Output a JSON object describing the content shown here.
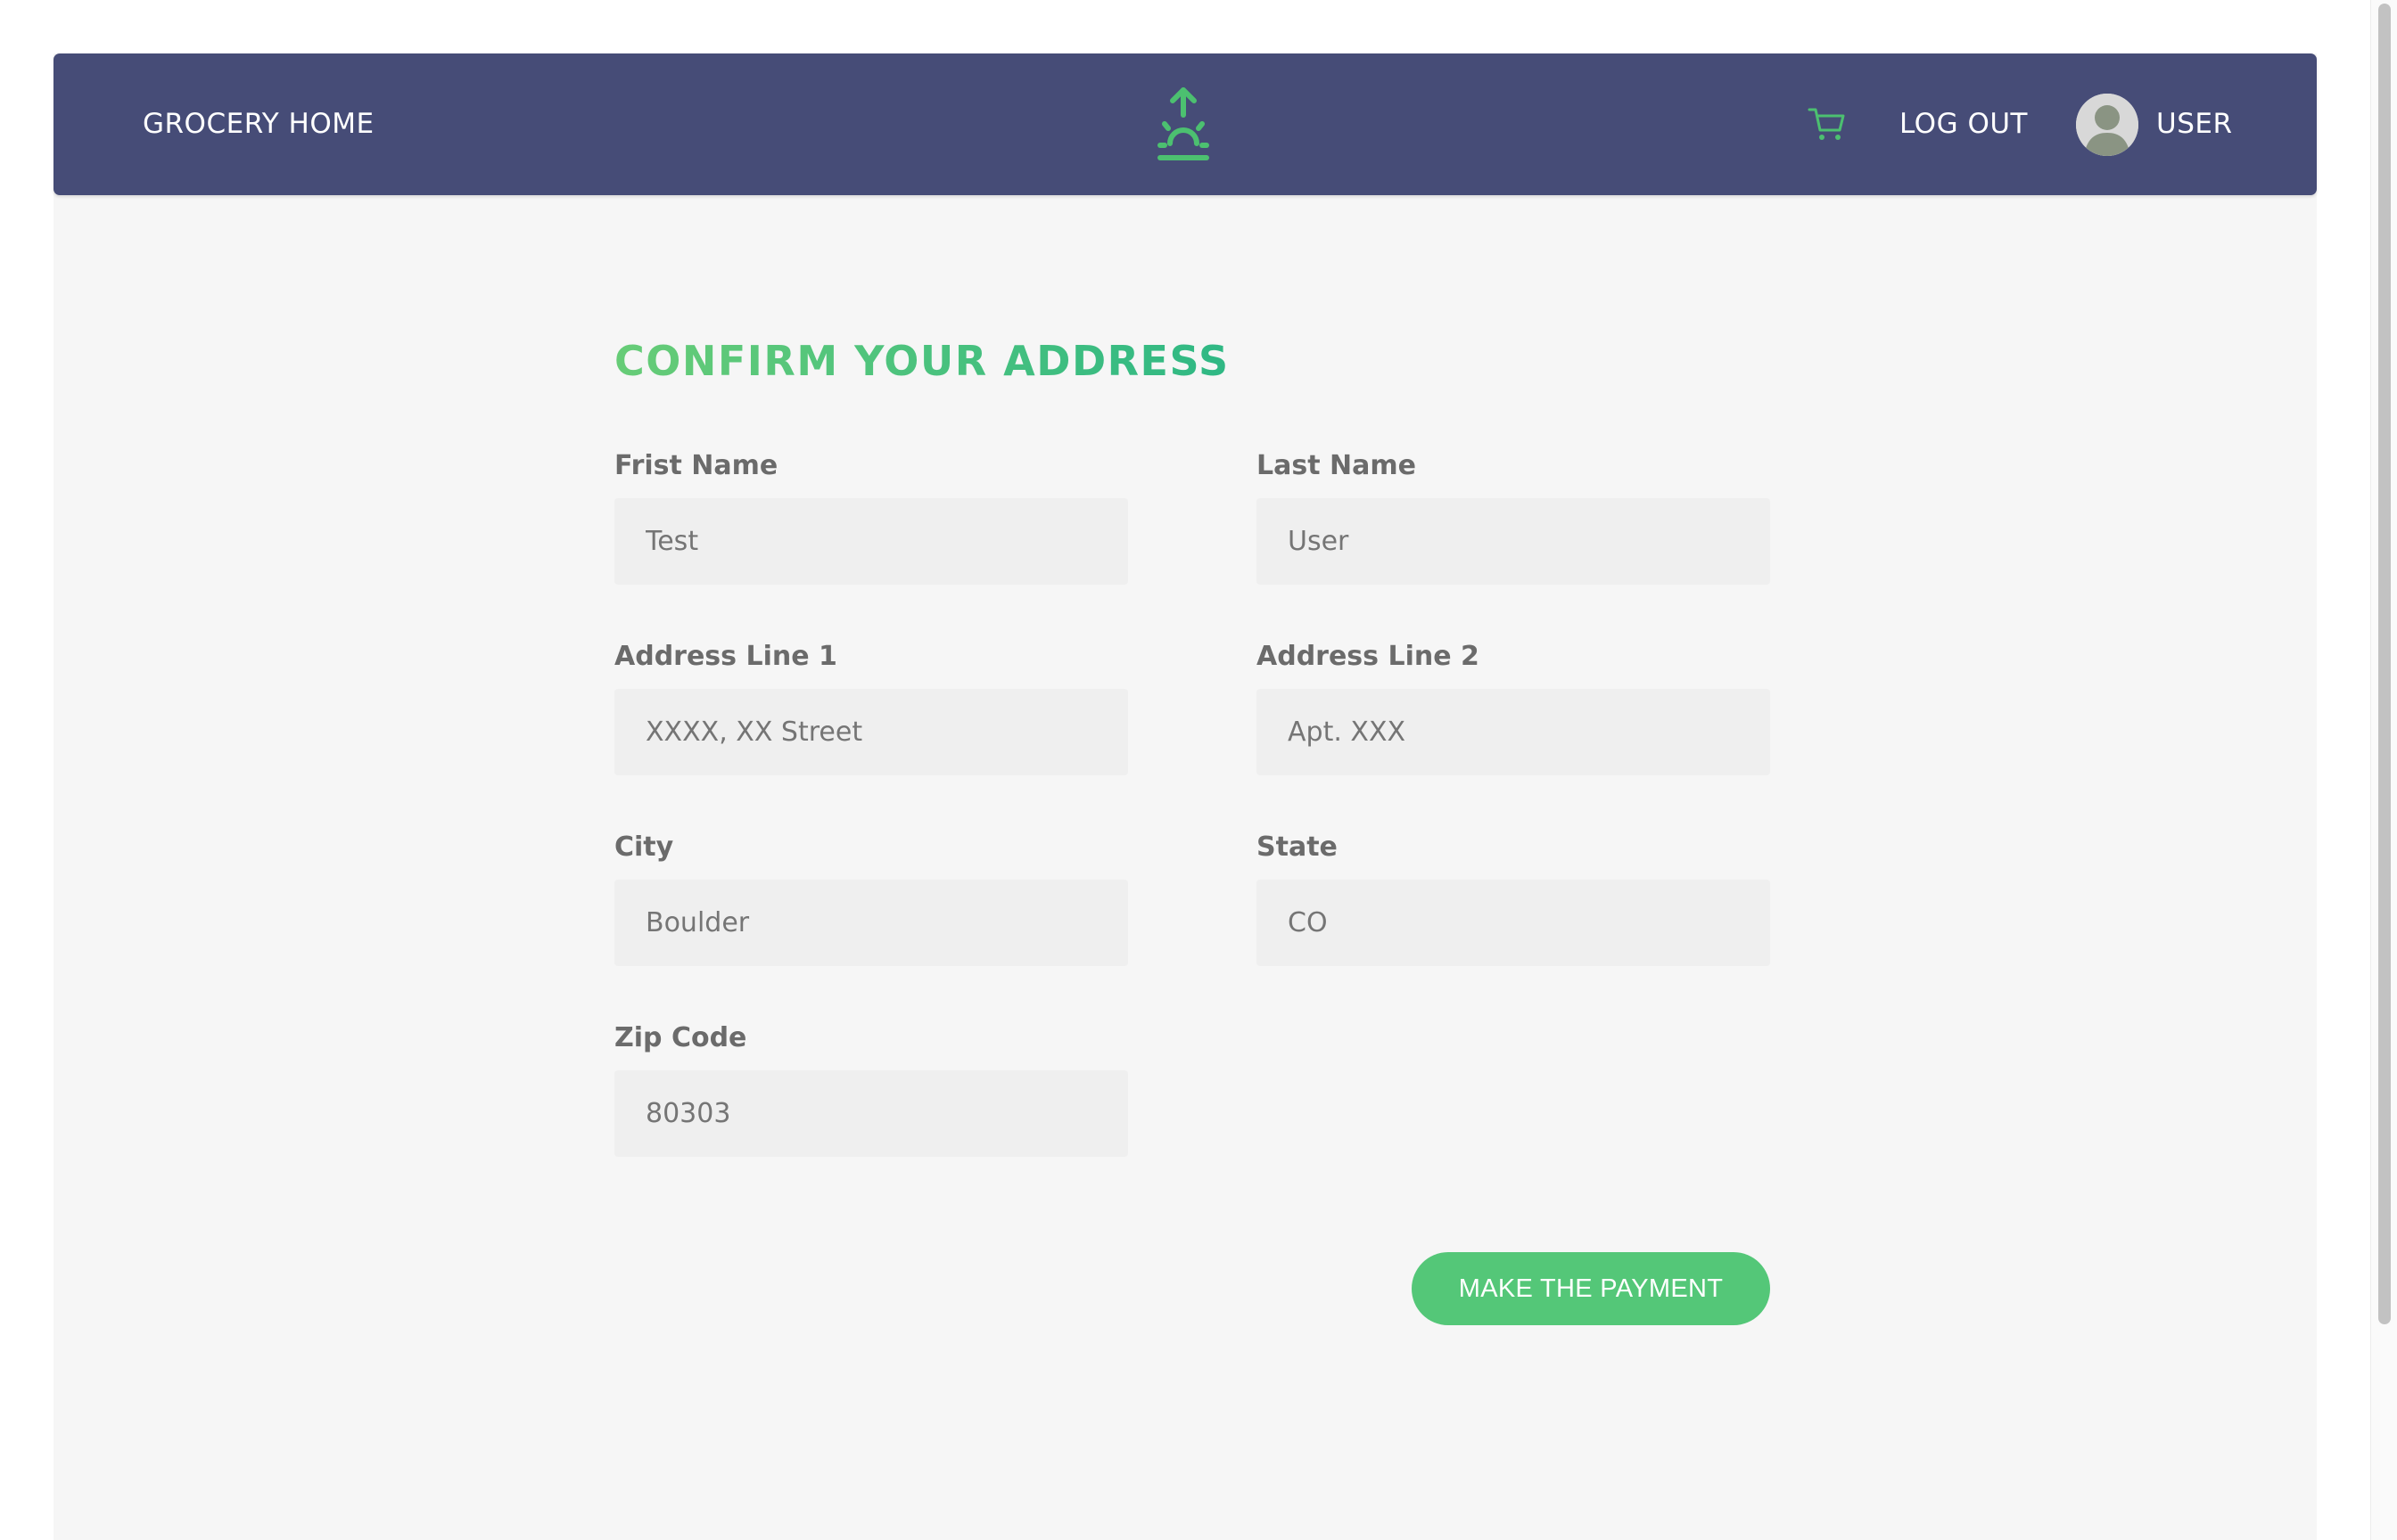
{
  "nav": {
    "home_label": "GROCERY HOME",
    "logo_icon": "sunrise-icon",
    "cart_icon": "shopping-cart-icon",
    "logout_label": "LOG OUT",
    "avatar_icon": "user-avatar-icon",
    "user_label": "USER"
  },
  "form": {
    "heading": "CONFIRM YOUR ADDRESS",
    "first_name": {
      "label": "Frist Name",
      "placeholder": "Test"
    },
    "last_name": {
      "label": "Last Name",
      "placeholder": "User"
    },
    "address_line_1": {
      "label": "Address Line 1",
      "placeholder": "XXXX, XX Street"
    },
    "address_line_2": {
      "label": "Address Line 2",
      "placeholder": "Apt. XXX"
    },
    "city": {
      "label": "City",
      "placeholder": "Boulder"
    },
    "state": {
      "label": "State",
      "placeholder": "CO"
    },
    "zip_code": {
      "label": "Zip Code",
      "placeholder": "80303"
    },
    "submit_label": "MAKE THE PAYMENT"
  },
  "colors": {
    "header_bg": "#464c77",
    "accent_green": "#54c778",
    "heading_gradient_start": "#67cc77",
    "heading_gradient_end": "#2fb884",
    "page_bg": "#f6f6f6",
    "input_bg": "#efefef"
  }
}
